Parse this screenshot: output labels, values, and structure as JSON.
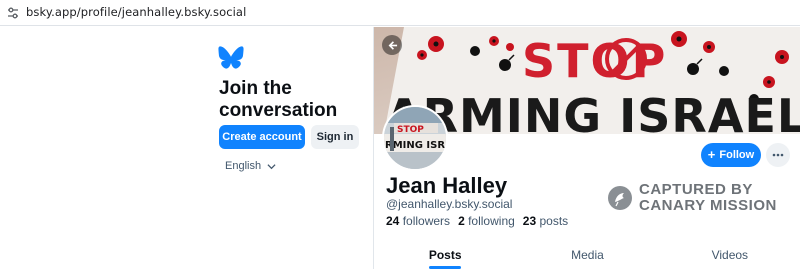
{
  "browser": {
    "url": "bsky.app/profile/jeanhalley.bsky.social",
    "site_icon": "tune-icon"
  },
  "signup": {
    "logo_icon": "butterfly-icon",
    "heading": "Join the conversation",
    "create_account_label": "Create account",
    "sign_in_label": "Sign in",
    "language": "English"
  },
  "profile": {
    "banner_text_line1": "STOP",
    "banner_text_line2": "ARMING ISRAEL",
    "avatar_text_line1": "STOP",
    "avatar_text_line2": "RMING ISRAE",
    "display_name": "Jean Halley",
    "handle": "@jeanhalley.bsky.social",
    "followers_count": "24",
    "followers_label": "followers",
    "following_count": "2",
    "following_label": "following",
    "posts_count": "23",
    "posts_label": "posts",
    "follow_label": "Follow"
  },
  "watermark": {
    "line1": "CAPTURED BY",
    "line2": "CANARY MISSION"
  },
  "tabs": [
    {
      "label": "Posts",
      "active": true
    },
    {
      "label": "Media",
      "active": false
    },
    {
      "label": "Videos",
      "active": false
    }
  ],
  "colors": {
    "accent": "#1083fe",
    "banner_paint_red": "#d0202e",
    "banner_paint_black": "#1a1a1a"
  }
}
